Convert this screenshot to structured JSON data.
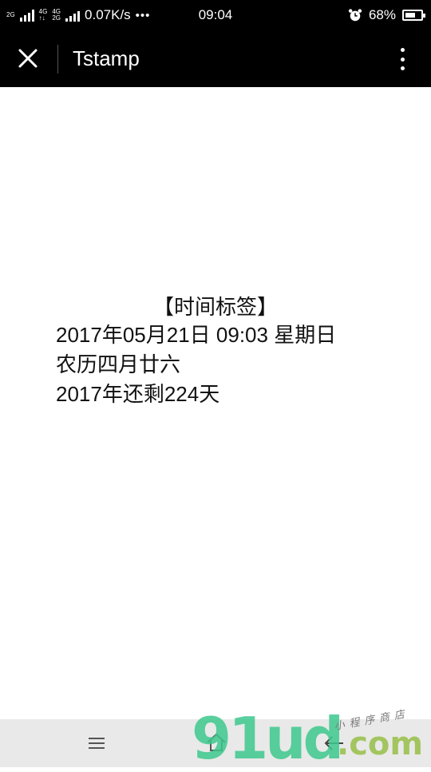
{
  "status_bar": {
    "net_tag_1": "2G",
    "net_tag_2": "4G",
    "net_tag_3": "4G",
    "net_tag_4": "2G",
    "speed": "0.07K/s",
    "dots": "•••",
    "time": "09:04",
    "battery": "68%",
    "battery_level": 0.68
  },
  "nav_bar": {
    "title": "Tstamp",
    "close_icon": "close-icon",
    "more_icon": "more-vertical-icon"
  },
  "stamp": {
    "title": "【时间标签】",
    "line1": "2017年05月21日 09:03 星期日",
    "line2": "农历四月廿六",
    "line3": "2017年还剩224天"
  },
  "bottom_bar": {
    "menu_icon": "menu-icon",
    "home_icon": "home-icon",
    "back_icon": "back-arrow-icon"
  },
  "watermark": {
    "brand": "91ud",
    "domain": ".com",
    "tagline": "小程序商店"
  }
}
